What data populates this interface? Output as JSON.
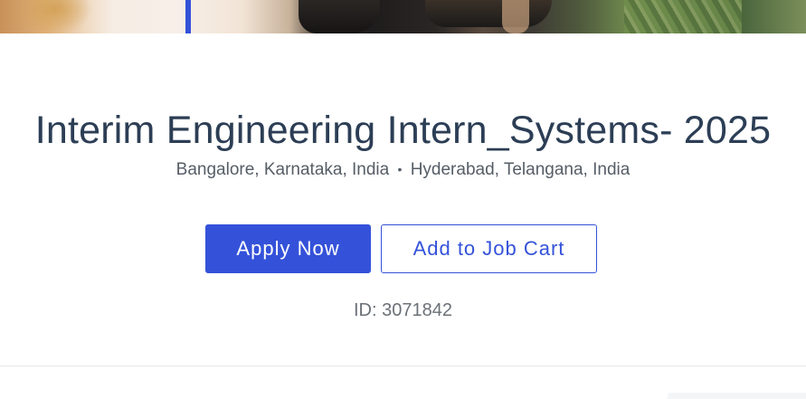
{
  "job": {
    "title": "Interim Engineering Intern_Systems- 2025",
    "locations": [
      "Bangalore, Karnataka, India",
      "Hyderabad, Telangana, India"
    ],
    "location_separator": "•",
    "id_label": "ID: 3071842"
  },
  "actions": {
    "apply_label": "Apply Now",
    "cart_label": "Add to Job Cart"
  },
  "colors": {
    "accent": "#3452d9",
    "title": "#2c3e55",
    "subtext": "#555d66"
  }
}
